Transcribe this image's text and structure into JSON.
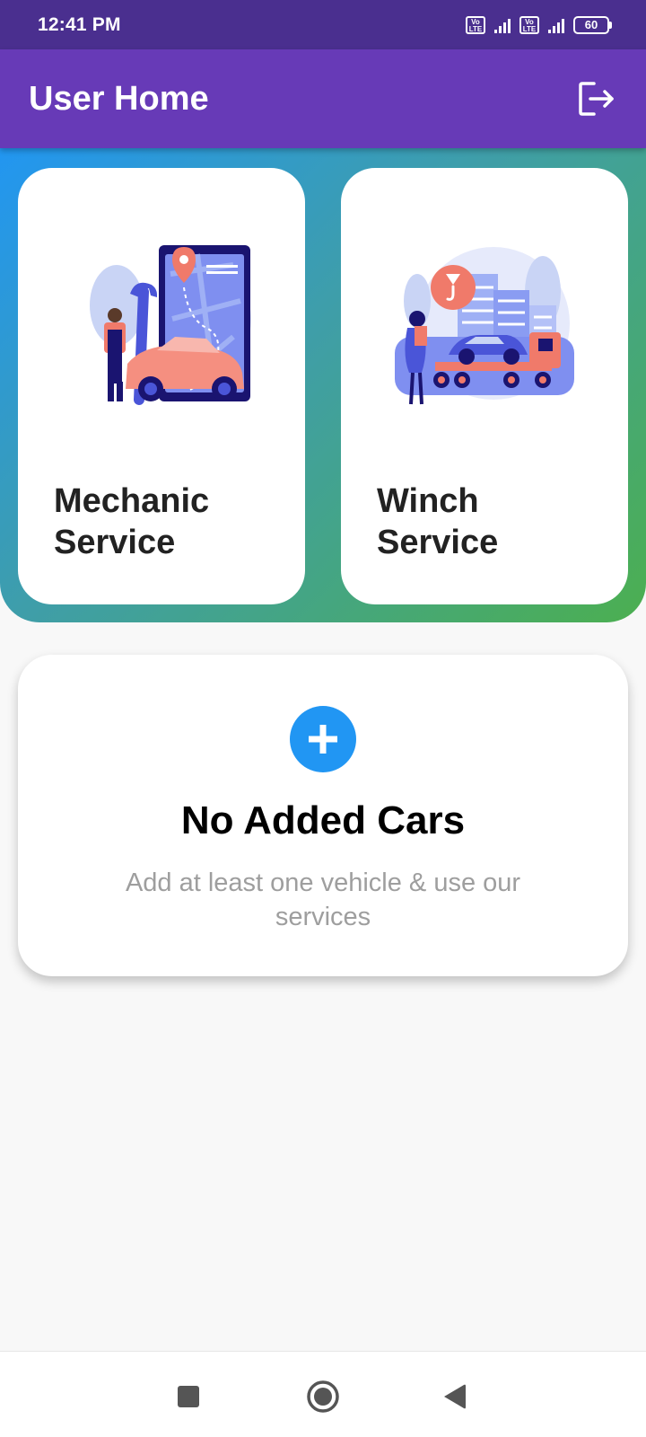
{
  "status_bar": {
    "time": "12:41 PM",
    "sim1": "Vo LTE",
    "sim2": "Vo LTE",
    "battery": "60"
  },
  "app_bar": {
    "title": "User Home",
    "logout_icon": "logout-icon"
  },
  "services": [
    {
      "label_line1": "Mechanic",
      "label_line2": "Service",
      "icon": "mechanic-illustration"
    },
    {
      "label_line1": "Winch",
      "label_line2": "Service",
      "icon": "tow-truck-illustration"
    }
  ],
  "empty_state": {
    "icon": "plus-icon",
    "title": "No Added Cars",
    "subtitle": "Add at least one vehicle & use our services"
  },
  "nav_bar": {
    "recents_icon": "square-icon",
    "home_icon": "circle-icon",
    "back_icon": "triangle-back-icon"
  },
  "colors": {
    "status_bar": "#4a2f8f",
    "app_bar": "#673ab7",
    "gradient_start": "#2196f3",
    "gradient_end": "#4caf50",
    "accent": "#2196f3"
  }
}
